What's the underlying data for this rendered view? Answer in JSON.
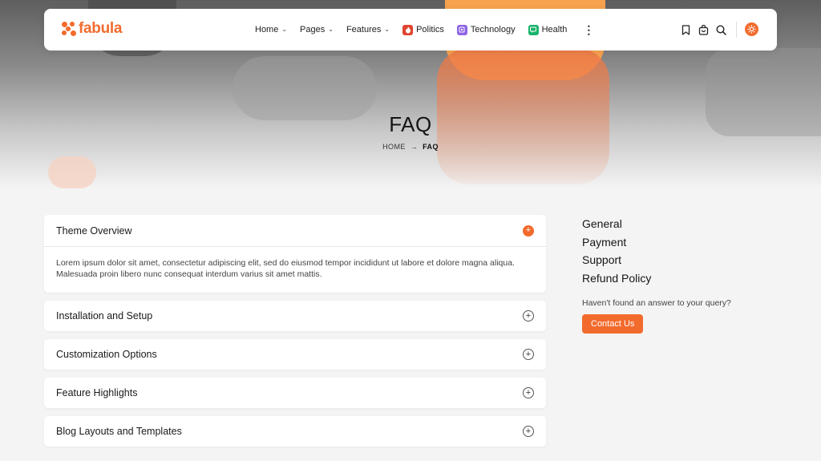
{
  "brand": {
    "name": "fabula",
    "accent_color": "#f26b2d"
  },
  "nav": {
    "items": [
      {
        "label": "Home",
        "has_dropdown": true
      },
      {
        "label": "Pages",
        "has_dropdown": true
      },
      {
        "label": "Features",
        "has_dropdown": true
      },
      {
        "label": "Politics",
        "icon": "flame-icon",
        "color": "#e0442f"
      },
      {
        "label": "Technology",
        "icon": "chip-icon",
        "color": "#8e64e6"
      },
      {
        "label": "Health",
        "icon": "chat-icon",
        "color": "#19b36b"
      }
    ],
    "more": "⋮"
  },
  "header_icons": [
    "bookmark-icon",
    "cart-icon",
    "search-icon",
    "sun-icon"
  ],
  "page": {
    "title": "FAQ"
  },
  "breadcrumb": {
    "home": "HOME",
    "current": "FAQ"
  },
  "faq": {
    "items": [
      {
        "question": "Theme Overview",
        "answer": "Lorem ipsum dolor sit amet, consectetur adipiscing elit, sed do eiusmod tempor incididunt ut labore et dolore magna aliqua. Malesuada proin libero nunc consequat interdum varius sit amet mattis.",
        "open": true
      },
      {
        "question": "Installation and Setup",
        "open": false
      },
      {
        "question": "Customization Options",
        "open": false
      },
      {
        "question": "Feature Highlights",
        "open": false
      },
      {
        "question": "Blog Layouts and Templates",
        "open": false
      }
    ]
  },
  "sidebar": {
    "links": [
      "General",
      "Payment",
      "Support",
      "Refund Policy"
    ],
    "help_text": "Haven't found an answer to your query?",
    "contact_label": "Contact Us"
  }
}
